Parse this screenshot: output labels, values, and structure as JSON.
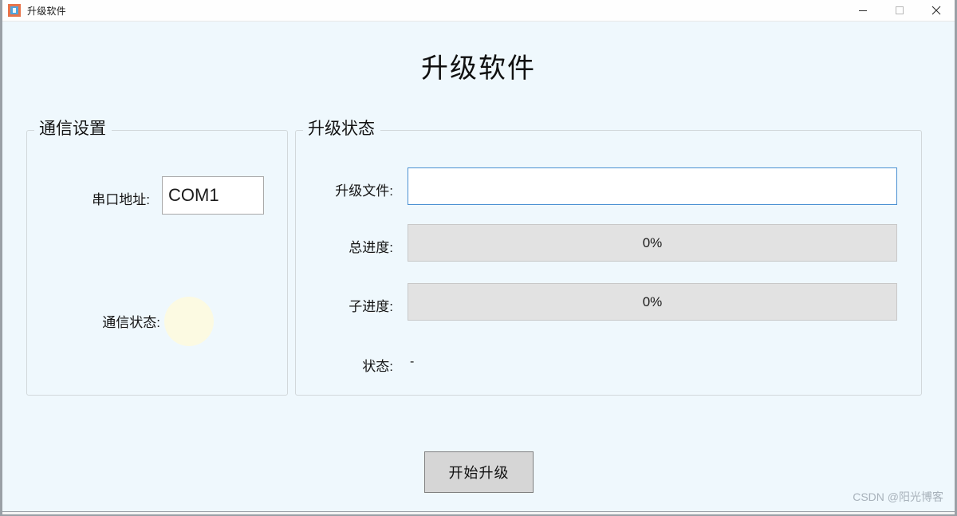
{
  "window": {
    "title": "升级软件",
    "icon": "app-icon",
    "controls": {
      "minimize": "minimize-icon",
      "maximize": "maximize-icon",
      "close": "close-icon"
    }
  },
  "heading": "升级软件",
  "groups": {
    "communication": {
      "legend": "通信设置",
      "serial_label": "串口地址:",
      "serial_value": "COM1",
      "serial_placeholder": "",
      "status_label": "通信状态:",
      "status_lamp_color": "#fcfae2"
    },
    "upgrade": {
      "legend": "升级状态",
      "file_label": "升级文件:",
      "file_value": "",
      "file_placeholder": "",
      "total_progress_label": "总进度:",
      "total_progress_text": "0%",
      "total_progress_percent": 0,
      "sub_progress_label": "子进度:",
      "sub_progress_text": "0%",
      "sub_progress_percent": 0,
      "state_label": "状态:",
      "state_value": "-"
    }
  },
  "actions": {
    "start_upgrade": "开始升级"
  },
  "watermark": "CSDN @阳光博客",
  "colors": {
    "background": "#eff8fd",
    "accent_border": "#4a90d2",
    "group_border": "#d2d8db",
    "progress_track": "#e2e2e2",
    "button_face": "#d6d6d6",
    "lamp": "#fcfae2"
  }
}
